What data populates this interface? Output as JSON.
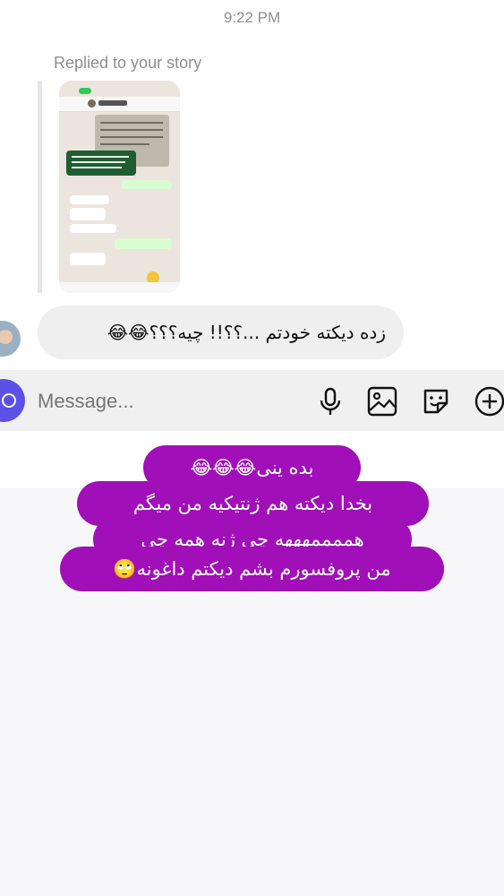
{
  "header": {
    "timestamp": "9:22 PM"
  },
  "story_reply": {
    "label": "Replied to your story"
  },
  "message": {
    "text": "زده دیکته خودتم ...؟؟!! چیه؟؟؟😂😂"
  },
  "composer": {
    "placeholder": "Message...",
    "icons": [
      "camera-icon",
      "microphone-icon",
      "gallery-icon",
      "sticker-icon",
      "add-icon"
    ],
    "accent_color": "#5b51e6"
  },
  "caption": {
    "background_color": "#a10fb8",
    "lines": [
      "بده ینی😂😂😂",
      "بخدا دیکته هم ژنتیکیه من میگم",
      "هممممهههه چی ژنه همه چی",
      "من پروفسورم بشم دیکتم داغونه🙄"
    ]
  }
}
